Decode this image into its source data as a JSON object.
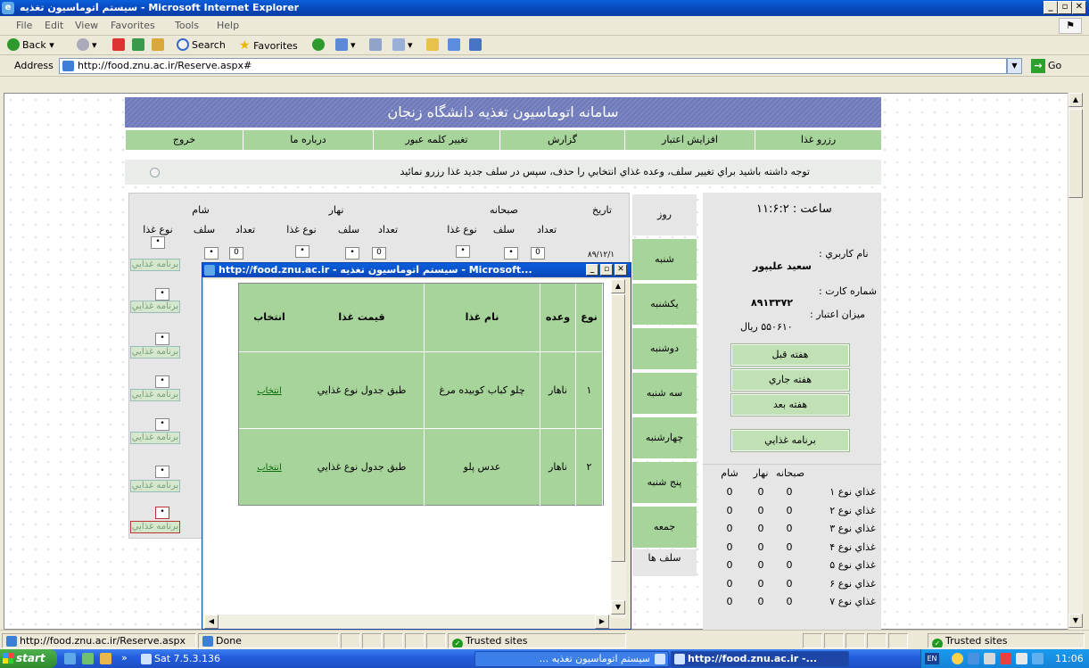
{
  "window": {
    "title": "سیستم اتوماسیون تغذیه - Microsoft Internet Explorer"
  },
  "menu": [
    "File",
    "Edit",
    "View",
    "Favorites",
    "Tools",
    "Help"
  ],
  "toolbar": {
    "back": "Back",
    "search": "Search",
    "favorites": "Favorites"
  },
  "address": {
    "label": "Address",
    "url": "http://food.znu.ac.ir/Reserve.aspx#",
    "go": "Go"
  },
  "site": {
    "header": "سامانه اتوماسیون تغذیه دانشگاه زنجان",
    "nav": [
      "رزرو غذا",
      "افزايش اعتبار",
      "گزارش",
      "تغيير كلمه عبور",
      "درباره ما",
      "خروج"
    ],
    "notice": "توجه داشته باشيد براي تغيير سلف، وعده غذاي انتخابي را حذف، سپس در سلف جديد غذا رزرو نمائيد"
  },
  "grid": {
    "date_header": "تاريخ",
    "meals": [
      "صبحانه",
      "نهار",
      "شام"
    ],
    "sub_headers": [
      "تعداد",
      "سلف",
      "نوع غذا"
    ],
    "count_value": "0",
    "date_partial": "۸۹/۱۲/۱",
    "program_label": "برنامه غذايي",
    "box_mark": "•"
  },
  "days": {
    "header": "روز",
    "items": [
      "شنبه",
      "يكشنبه",
      "دوشنبه",
      "سه شنبه",
      "چهارشنبه",
      "پنج شنبه",
      "جمعه"
    ],
    "selfs": "سلف ها"
  },
  "panel": {
    "clock_label": "ساعت :",
    "clock": "۱۱:۶:۲",
    "user_label": "نام كاربري :",
    "user": "سعيد عليپور",
    "card_label": "شماره كارت :",
    "card": "۸۹۱۳۳۷۲",
    "credit_label": "ميزان اعتبار :",
    "credit": "۵۵۰۶۱۰",
    "credit_unit": "ريال",
    "prev_week": "هفته قبل",
    "this_week": "هفته جاري",
    "next_week": "هفته بعد",
    "food_program": "برنامه غذايي",
    "meal_table": {
      "headers": [
        "صبحانه",
        "نهار",
        "شام"
      ],
      "rows": [
        {
          "label": "غذاي نوع ۱",
          "values": [
            "0",
            "0",
            "0"
          ]
        },
        {
          "label": "غذاي نوع ۲",
          "values": [
            "0",
            "0",
            "0"
          ]
        },
        {
          "label": "غذاي نوع ۳",
          "values": [
            "0",
            "0",
            "0"
          ]
        },
        {
          "label": "غذاي نوع ۴",
          "values": [
            "0",
            "0",
            "0"
          ]
        },
        {
          "label": "غذاي نوع ۵",
          "values": [
            "0",
            "0",
            "0"
          ]
        },
        {
          "label": "غذاي نوع ۶",
          "values": [
            "0",
            "0",
            "0"
          ]
        },
        {
          "label": "غذاي نوع ۷",
          "values": [
            "0",
            "0",
            "0"
          ]
        }
      ]
    }
  },
  "popup": {
    "title": "http://food.znu.ac.ir - سیستم اتوماسیون تغذیه - Microsoft...",
    "headers": [
      "نوع",
      "وعده",
      "نام غذا",
      "قيمت غذا",
      "انتخاب"
    ],
    "rows": [
      {
        "type": "۱",
        "meal": "ناهار",
        "food": "چلو کباب کوبیده مرغ",
        "price": "طبق جدول نوع غذايي",
        "select": "انتخاب"
      },
      {
        "type": "۲",
        "meal": "ناهار",
        "food": "عدس پلو",
        "price": "طبق جدول نوع غذايي",
        "select": "انتخاب"
      }
    ]
  },
  "status": {
    "url": "http://food.znu.ac.ir/Reserve.aspx",
    "popup_done": "Done",
    "zone": "Trusted sites",
    "zone_main": "Trusted sites"
  },
  "taskbar": {
    "start": "start",
    "quick": "Sat 7.5.3.136",
    "tasks": [
      "سیستم اتوماسیون تغذیه ...",
      "http://food.znu.ac.ir -..."
    ],
    "lang": "EN",
    "clock": "11:06"
  }
}
